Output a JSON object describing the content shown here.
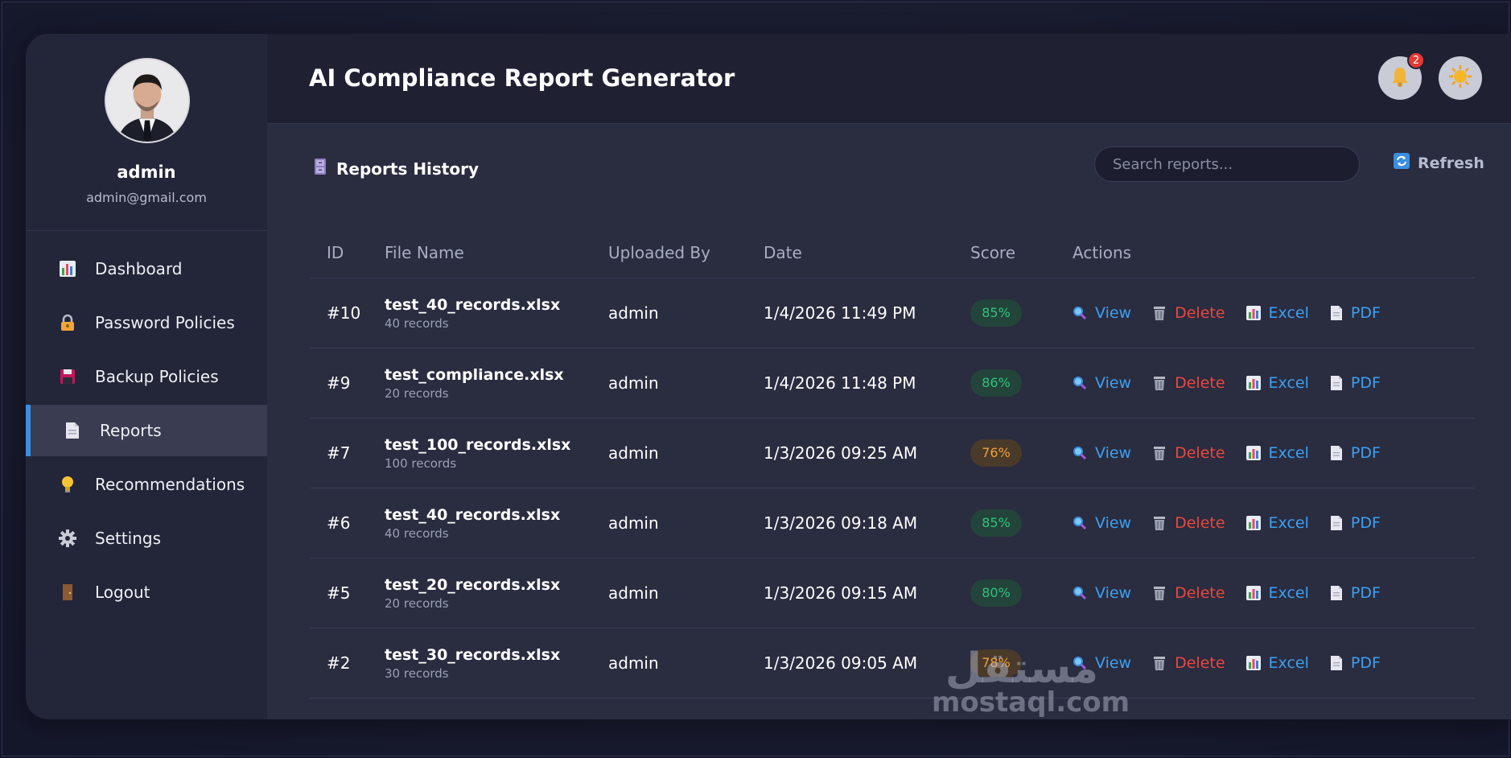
{
  "app": {
    "title": "AI Compliance Report Generator",
    "notification_count": "2"
  },
  "user": {
    "name": "admin",
    "email": "admin@gmail.com"
  },
  "sidebar": {
    "items": [
      {
        "label": "Dashboard",
        "icon": "chart-icon"
      },
      {
        "label": "Password Policies",
        "icon": "lock-icon"
      },
      {
        "label": "Backup Policies",
        "icon": "floppy-disk-icon"
      },
      {
        "label": "Reports",
        "icon": "document-icon",
        "active": true
      },
      {
        "label": "Recommendations",
        "icon": "lightbulb-icon"
      },
      {
        "label": "Settings",
        "icon": "gear-icon"
      },
      {
        "label": "Logout",
        "icon": "door-icon"
      }
    ]
  },
  "reports": {
    "title": "Reports History",
    "search_placeholder": "Search reports...",
    "refresh_label": "Refresh",
    "columns": [
      "ID",
      "File Name",
      "Uploaded By",
      "Date",
      "Score",
      "Actions"
    ],
    "actions": {
      "view": "View",
      "delete": "Delete",
      "excel": "Excel",
      "pdf": "PDF"
    },
    "rows": [
      {
        "id": "#10",
        "file": "test_40_records.xlsx",
        "records": "40 records",
        "user": "admin",
        "date": "1/4/2026 11:49 PM",
        "score": "85%",
        "status": "good"
      },
      {
        "id": "#9",
        "file": "test_compliance.xlsx",
        "records": "20 records",
        "user": "admin",
        "date": "1/4/2026 11:48 PM",
        "score": "86%",
        "status": "good"
      },
      {
        "id": "#7",
        "file": "test_100_records.xlsx",
        "records": "100 records",
        "user": "admin",
        "date": "1/3/2026 09:25 AM",
        "score": "76%",
        "status": "warn"
      },
      {
        "id": "#6",
        "file": "test_40_records.xlsx",
        "records": "40 records",
        "user": "admin",
        "date": "1/3/2026 09:18 AM",
        "score": "85%",
        "status": "good"
      },
      {
        "id": "#5",
        "file": "test_20_records.xlsx",
        "records": "20 records",
        "user": "admin",
        "date": "1/3/2026 09:15 AM",
        "score": "80%",
        "status": "good"
      },
      {
        "id": "#2",
        "file": "test_30_records.xlsx",
        "records": "30 records",
        "user": "admin",
        "date": "1/3/2026 09:05 AM",
        "score": "78%",
        "status": "warn"
      }
    ]
  },
  "watermark": {
    "arabic": "مستقل",
    "latin": "mostaql.com"
  },
  "colors": {
    "accent": "#3b8ee0",
    "good": "#2ec27e",
    "warn": "#f0a13a",
    "danger": "#e8483e",
    "link": "#3ea0f0"
  }
}
